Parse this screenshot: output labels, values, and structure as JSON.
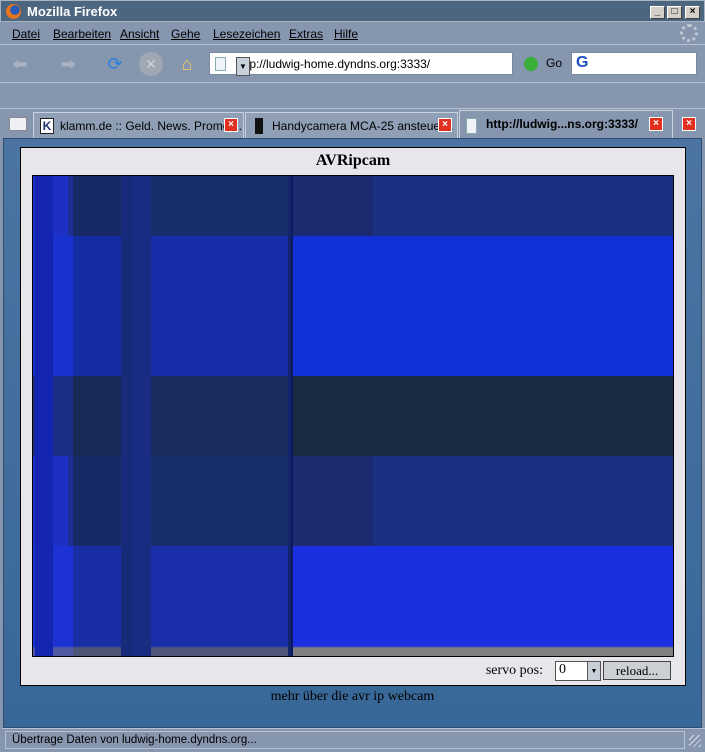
{
  "window": {
    "title": "Mozilla Firefox",
    "min": "_",
    "max": "□",
    "close": "×"
  },
  "menu": [
    "Datei",
    "Bearbeiten",
    "Ansicht",
    "Gehe",
    "Lesezeichen",
    "Extras",
    "Hilfe"
  ],
  "toolbar": {
    "url": "http://ludwig-home.dyndns.org:3333/",
    "go_label": "Go",
    "search_value": ""
  },
  "tabs": [
    {
      "label": "klamm.de :: Geld. News. Promoti...",
      "icon": "K"
    },
    {
      "label": "Handycamera MCA-25 ansteuer...",
      "icon": "AVR"
    },
    {
      "label": "http://ludwig...ns.org:3333/",
      "icon": "page"
    }
  ],
  "page": {
    "title": "AVRipcam",
    "servo_label": "servo pos:",
    "servo_value": "0",
    "reload_label": "reload...",
    "more_text": "mehr über die ",
    "more_link": "avr ip webcam"
  },
  "status": "Übertrage Daten von ludwig-home.dyndns.org..."
}
